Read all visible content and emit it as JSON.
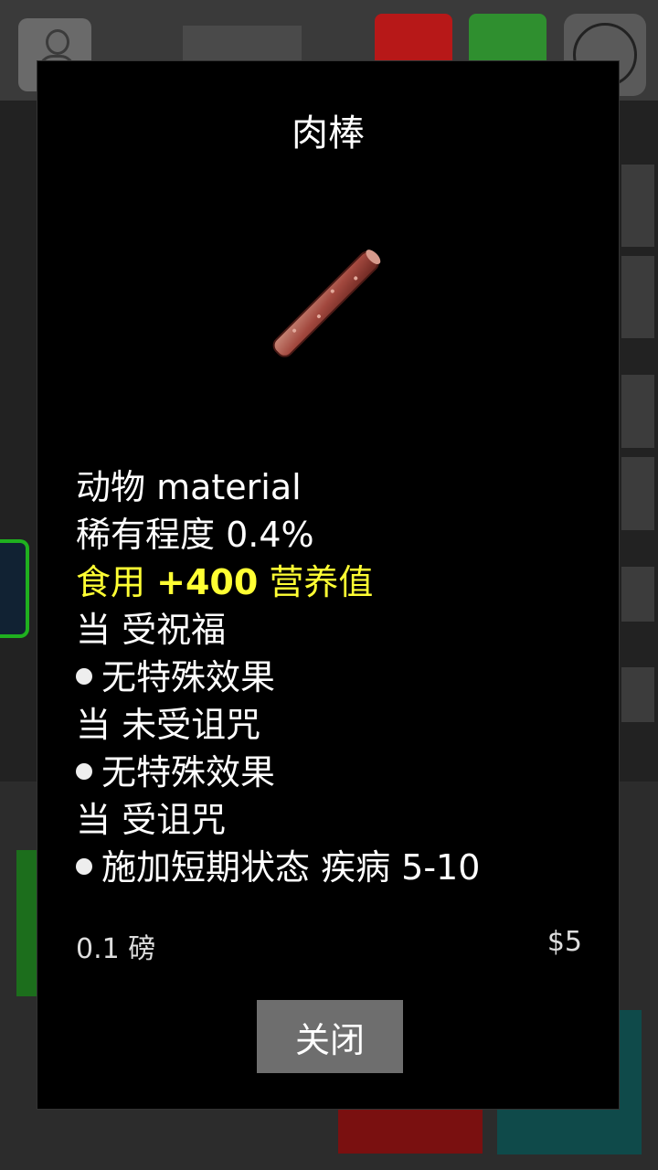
{
  "dialog": {
    "title": "肉棒",
    "item_icon": "meat-stick-icon",
    "lines": {
      "category": "动物 material",
      "rarity": "稀有程度 0.4%",
      "edible_prefix": "食用",
      "edible_value": "+400",
      "edible_suffix": "营养值",
      "blessed_header": "当 受祝福",
      "blessed_effect": "无特殊效果",
      "uncursed_header": "当 未受诅咒",
      "uncursed_effect": "无特殊效果",
      "cursed_header": "当 受诅咒",
      "cursed_effect": "施加短期状态 疾病 5-10"
    },
    "weight": "0.1 磅",
    "price": "$5",
    "close_label": "关闭"
  },
  "colors": {
    "modal_bg": "#000000",
    "highlight": "#ffff33",
    "button_bg": "#6e6e6e"
  }
}
